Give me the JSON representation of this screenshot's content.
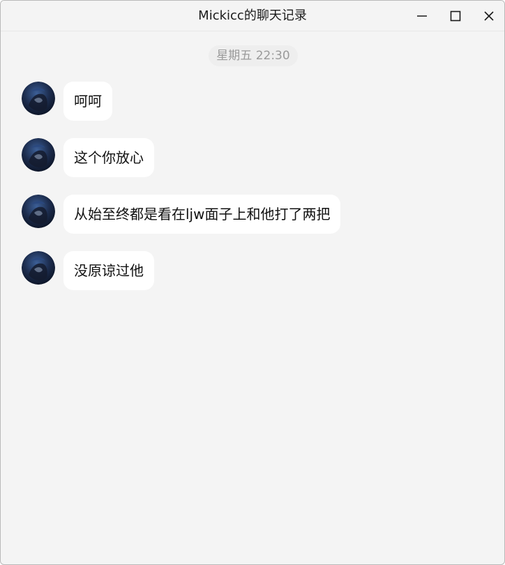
{
  "window": {
    "title": "Mickicc的聊天记录"
  },
  "titlebar_icons": {
    "minimize": "minimize-icon",
    "maximize": "maximize-icon",
    "close": "close-icon"
  },
  "chat": {
    "timestamp": "星期五 22:30",
    "messages": [
      {
        "text": "呵呵"
      },
      {
        "text": "这个你放心"
      },
      {
        "text": "从始至终都是看在ljw面子上和他打了两把"
      },
      {
        "text": "没原谅过他"
      }
    ]
  },
  "colors": {
    "background": "#f4f4f4",
    "bubble": "#ffffff",
    "timestamp_text": "#9a9a9a"
  }
}
